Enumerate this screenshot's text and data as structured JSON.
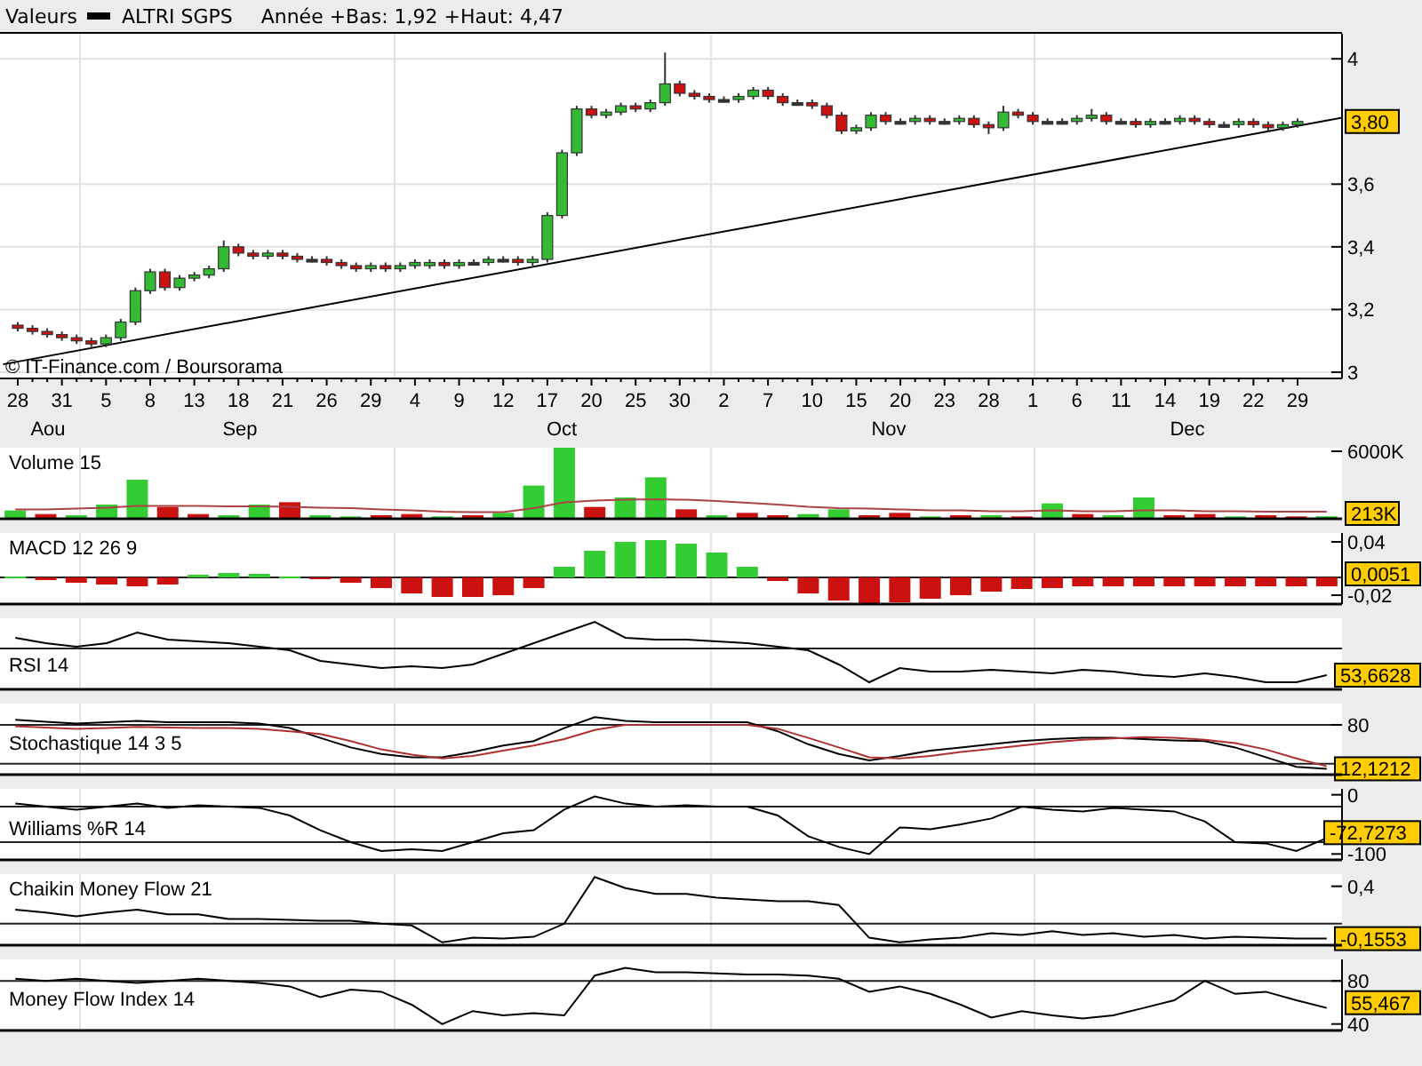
{
  "header": {
    "title": "Valeurs",
    "symbol": "ALTRI SGPS",
    "range": "Année +Bas: 1,92 +Haut: 4,47"
  },
  "price_chart": {
    "reading": "3,80",
    "credit": "© IT-Finance.com / Boursorama",
    "months": [
      "Aou",
      "Sep",
      "Oct",
      "Nov",
      "Dec"
    ],
    "chart_data": {
      "type": "candlestick",
      "grid": true,
      "ylim": [
        2.98,
        4.08
      ],
      "yticks": [
        {
          "value": 3,
          "label": "3"
        },
        {
          "value": 3.2,
          "label": "3,2"
        },
        {
          "value": 3.4,
          "label": "3,4"
        },
        {
          "value": 3.6,
          "label": "3,6"
        },
        {
          "value": 4,
          "label": "4"
        }
      ],
      "categories": [
        "28",
        null,
        null,
        "31",
        null,
        null,
        "5",
        null,
        null,
        "8",
        null,
        null,
        "13",
        null,
        null,
        "18",
        null,
        null,
        "21",
        null,
        null,
        "26",
        null,
        null,
        "29",
        null,
        null,
        "4",
        null,
        null,
        "9",
        null,
        null,
        "12",
        null,
        null,
        "17",
        null,
        null,
        "20",
        null,
        null,
        "25",
        null,
        null,
        "30",
        null,
        null,
        "2",
        null,
        null,
        "7",
        null,
        null,
        "10",
        null,
        null,
        "15",
        null,
        null,
        "20",
        null,
        null,
        "23",
        null,
        null,
        "28",
        null,
        null,
        "1",
        null,
        null,
        "6",
        null,
        null,
        "11",
        null,
        null,
        "14",
        null,
        null,
        "19",
        null,
        null,
        "22",
        null,
        null,
        "29"
      ],
      "ohlc": [
        [
          3.15,
          3.16,
          3.13,
          3.14
        ],
        [
          3.14,
          3.15,
          3.12,
          3.13
        ],
        [
          3.13,
          3.14,
          3.11,
          3.12
        ],
        [
          3.12,
          3.13,
          3.1,
          3.11
        ],
        [
          3.11,
          3.12,
          3.09,
          3.1
        ],
        [
          3.1,
          3.11,
          3.08,
          3.09
        ],
        [
          3.09,
          3.12,
          3.08,
          3.11
        ],
        [
          3.11,
          3.17,
          3.1,
          3.16
        ],
        [
          3.16,
          3.27,
          3.15,
          3.26
        ],
        [
          3.26,
          3.33,
          3.25,
          3.32
        ],
        [
          3.32,
          3.33,
          3.26,
          3.27
        ],
        [
          3.27,
          3.31,
          3.26,
          3.3
        ],
        [
          3.3,
          3.32,
          3.29,
          3.31
        ],
        [
          3.31,
          3.34,
          3.3,
          3.33
        ],
        [
          3.33,
          3.42,
          3.32,
          3.4
        ],
        [
          3.4,
          3.41,
          3.37,
          3.38
        ],
        [
          3.38,
          3.39,
          3.36,
          3.37
        ],
        [
          3.37,
          3.39,
          3.36,
          3.38
        ],
        [
          3.38,
          3.39,
          3.36,
          3.37
        ],
        [
          3.37,
          3.38,
          3.35,
          3.36
        ],
        [
          3.36,
          3.37,
          3.35,
          3.36
        ],
        [
          3.36,
          3.37,
          3.34,
          3.35
        ],
        [
          3.35,
          3.36,
          3.33,
          3.34
        ],
        [
          3.34,
          3.35,
          3.32,
          3.33
        ],
        [
          3.33,
          3.35,
          3.32,
          3.34
        ],
        [
          3.34,
          3.35,
          3.32,
          3.33
        ],
        [
          3.33,
          3.35,
          3.32,
          3.34
        ],
        [
          3.34,
          3.36,
          3.33,
          3.35
        ],
        [
          3.34,
          3.36,
          3.33,
          3.35
        ],
        [
          3.35,
          3.36,
          3.33,
          3.34
        ],
        [
          3.34,
          3.36,
          3.33,
          3.35
        ],
        [
          3.35,
          3.36,
          3.34,
          3.35
        ],
        [
          3.35,
          3.37,
          3.34,
          3.36
        ],
        [
          3.36,
          3.37,
          3.35,
          3.36
        ],
        [
          3.36,
          3.37,
          3.34,
          3.35
        ],
        [
          3.35,
          3.37,
          3.34,
          3.36
        ],
        [
          3.36,
          3.51,
          3.35,
          3.5
        ],
        [
          3.5,
          3.71,
          3.49,
          3.7
        ],
        [
          3.7,
          3.85,
          3.69,
          3.84
        ],
        [
          3.84,
          3.85,
          3.81,
          3.82
        ],
        [
          3.82,
          3.84,
          3.81,
          3.83
        ],
        [
          3.83,
          3.86,
          3.82,
          3.85
        ],
        [
          3.85,
          3.86,
          3.83,
          3.84
        ],
        [
          3.84,
          3.87,
          3.83,
          3.86
        ],
        [
          3.86,
          4.02,
          3.85,
          3.92
        ],
        [
          3.92,
          3.93,
          3.88,
          3.89
        ],
        [
          3.89,
          3.9,
          3.87,
          3.88
        ],
        [
          3.88,
          3.89,
          3.86,
          3.87
        ],
        [
          3.87,
          3.88,
          3.86,
          3.87
        ],
        [
          3.87,
          3.89,
          3.86,
          3.88
        ],
        [
          3.88,
          3.91,
          3.87,
          3.9
        ],
        [
          3.9,
          3.91,
          3.87,
          3.88
        ],
        [
          3.88,
          3.89,
          3.85,
          3.86
        ],
        [
          3.86,
          3.87,
          3.85,
          3.86
        ],
        [
          3.86,
          3.87,
          3.84,
          3.85
        ],
        [
          3.85,
          3.86,
          3.81,
          3.82
        ],
        [
          3.82,
          3.83,
          3.76,
          3.77
        ],
        [
          3.77,
          3.79,
          3.76,
          3.78
        ],
        [
          3.78,
          3.83,
          3.77,
          3.82
        ],
        [
          3.82,
          3.83,
          3.79,
          3.8
        ],
        [
          3.8,
          3.81,
          3.79,
          3.8
        ],
        [
          3.8,
          3.82,
          3.79,
          3.81
        ],
        [
          3.81,
          3.82,
          3.79,
          3.8
        ],
        [
          3.8,
          3.81,
          3.79,
          3.8
        ],
        [
          3.8,
          3.82,
          3.79,
          3.81
        ],
        [
          3.81,
          3.82,
          3.78,
          3.79
        ],
        [
          3.79,
          3.8,
          3.76,
          3.78
        ],
        [
          3.78,
          3.85,
          3.77,
          3.83
        ],
        [
          3.83,
          3.84,
          3.81,
          3.82
        ],
        [
          3.82,
          3.83,
          3.79,
          3.8
        ],
        [
          3.8,
          3.81,
          3.79,
          3.8
        ],
        [
          3.8,
          3.81,
          3.79,
          3.8
        ],
        [
          3.8,
          3.82,
          3.79,
          3.81
        ],
        [
          3.81,
          3.84,
          3.8,
          3.82
        ],
        [
          3.82,
          3.83,
          3.79,
          3.8
        ],
        [
          3.8,
          3.81,
          3.79,
          3.8
        ],
        [
          3.8,
          3.81,
          3.78,
          3.79
        ],
        [
          3.79,
          3.81,
          3.78,
          3.8
        ],
        [
          3.8,
          3.81,
          3.79,
          3.8
        ],
        [
          3.8,
          3.82,
          3.79,
          3.81
        ],
        [
          3.81,
          3.82,
          3.79,
          3.8
        ],
        [
          3.8,
          3.81,
          3.78,
          3.79
        ],
        [
          3.79,
          3.8,
          3.78,
          3.79
        ],
        [
          3.79,
          3.81,
          3.78,
          3.8
        ],
        [
          3.8,
          3.81,
          3.78,
          3.79
        ],
        [
          3.79,
          3.8,
          3.77,
          3.78
        ],
        [
          3.78,
          3.8,
          3.77,
          3.79
        ],
        [
          3.79,
          3.81,
          3.78,
          3.8
        ]
      ]
    }
  },
  "panels": [
    {
      "kind": "volume",
      "title": "Volume 15",
      "reading": "213K",
      "axis_labels": [
        "6000K"
      ]
    },
    {
      "kind": "chart",
      "title": "MACD 12 26 9",
      "reading": "0,0051",
      "chart_data": {
        "type": "bar",
        "ylim": [
          -0.03,
          0.05
        ],
        "yticks": [
          {
            "value": 0.04,
            "label": "0,04"
          },
          {
            "value": -0.02,
            "label": "-0,02"
          }
        ],
        "ref_lines": [
          {
            "axis": "y",
            "value": 0
          }
        ],
        "categories": [
          null,
          null,
          null,
          null,
          null,
          null,
          null,
          null,
          null,
          null,
          null,
          null,
          null,
          null,
          null,
          null,
          null,
          null,
          null,
          null,
          null,
          null,
          null,
          null,
          null,
          null,
          null,
          null,
          null,
          null,
          null,
          null,
          null,
          null,
          null,
          null,
          null,
          null,
          null,
          null,
          null,
          null,
          null,
          null
        ],
        "series": [
          {
            "color": "#33cc33",
            "values": [
              0.001,
              null,
              null,
              null,
              null,
              null,
              0.003,
              0.005,
              0.004,
              0.001,
              null,
              null,
              null,
              null,
              null,
              null,
              null,
              null,
              0.012,
              0.03,
              0.04,
              0.042,
              0.038,
              0.028,
              0.012,
              null,
              null,
              null,
              null,
              null,
              null,
              null,
              null,
              null,
              null,
              null,
              null,
              null,
              null,
              null,
              null,
              null,
              null,
              null
            ]
          },
          {
            "color": "#cc1111",
            "values": [
              null,
              -0.003,
              -0.006,
              -0.008,
              -0.01,
              -0.008,
              null,
              null,
              null,
              null,
              -0.002,
              -0.006,
              -0.012,
              -0.018,
              -0.022,
              -0.022,
              -0.02,
              -0.012,
              null,
              null,
              null,
              null,
              null,
              null,
              null,
              -0.004,
              -0.018,
              -0.026,
              -0.03,
              -0.028,
              -0.024,
              -0.02,
              -0.016,
              -0.013,
              -0.012,
              -0.01,
              -0.01,
              -0.01,
              -0.01,
              -0.01,
              -0.01,
              -0.01,
              -0.01,
              -0.01
            ]
          }
        ]
      }
    },
    {
      "kind": "rsi",
      "title": "RSI 14",
      "reading": "53,6628"
    },
    {
      "kind": "stochastic",
      "title": "Stochastique 14 3 5",
      "reading": "12,1212",
      "axis_labels": [
        "80"
      ]
    },
    {
      "kind": "chart",
      "title": "Williams %R 14",
      "reading": "-72,7273",
      "chart_data": {
        "type": "line",
        "ylim": [
          -110,
          10
        ],
        "yticks": [
          {
            "value": 0,
            "label": "0"
          },
          {
            "value": -100,
            "label": "-100"
          }
        ],
        "ref_lines": [
          {
            "axis": "y",
            "value": -20
          },
          {
            "axis": "y",
            "value": -80
          }
        ],
        "categories": [
          null,
          null,
          null,
          null,
          null,
          null,
          null,
          null,
          null,
          null,
          null,
          null,
          null,
          null,
          null,
          null,
          null,
          null,
          null,
          null,
          null,
          null,
          null,
          null,
          null,
          null,
          null,
          null,
          null,
          null,
          null,
          null,
          null,
          null,
          null,
          null,
          null,
          null,
          null,
          null,
          null,
          null,
          null,
          null
        ],
        "series": [
          {
            "color": "#000000",
            "values": [
              -15,
              -20,
              -25,
              -20,
              -15,
              -22,
              -18,
              -20,
              -22,
              -35,
              -60,
              -80,
              -95,
              -92,
              -95,
              -80,
              -65,
              -60,
              -25,
              -3,
              -15,
              -20,
              -18,
              -20,
              -20,
              -35,
              -70,
              -88,
              -100,
              -55,
              -58,
              -50,
              -40,
              -20,
              -25,
              -28,
              -22,
              -25,
              -28,
              -45,
              -80,
              -82,
              -95,
              -73
            ]
          }
        ]
      }
    },
    {
      "kind": "flow",
      "title": "Chaikin Money Flow 21",
      "reading": "-0,1553",
      "axis_labels": [
        "0,4"
      ]
    },
    {
      "kind": "chart",
      "title": "Money Flow Index 14",
      "reading": "55,467",
      "chart_data": {
        "type": "line",
        "ylim": [
          34,
          100
        ],
        "yticks": [
          {
            "value": 80,
            "label": "80"
          },
          {
            "value": 40,
            "label": "40"
          }
        ],
        "ref_lines": [
          {
            "axis": "y",
            "value": 80
          }
        ],
        "categories": [
          null,
          null,
          null,
          null,
          null,
          null,
          null,
          null,
          null,
          null,
          null,
          null,
          null,
          null,
          null,
          null,
          null,
          null,
          null,
          null,
          null,
          null,
          null,
          null,
          null,
          null,
          null,
          null,
          null,
          null,
          null,
          null,
          null,
          null,
          null,
          null,
          null,
          null,
          null,
          null,
          null,
          null,
          null,
          null
        ],
        "series": [
          {
            "color": "#000000",
            "values": [
              82,
              80,
              82,
              80,
              78,
              80,
              82,
              80,
              78,
              75,
              65,
              72,
              70,
              58,
              40,
              52,
              48,
              50,
              48,
              85,
              92,
              88,
              88,
              87,
              86,
              86,
              85,
              82,
              70,
              75,
              68,
              58,
              46,
              52,
              48,
              45,
              48,
              55,
              62,
              80,
              68,
              70,
              62,
              55
            ]
          }
        ]
      }
    }
  ]
}
